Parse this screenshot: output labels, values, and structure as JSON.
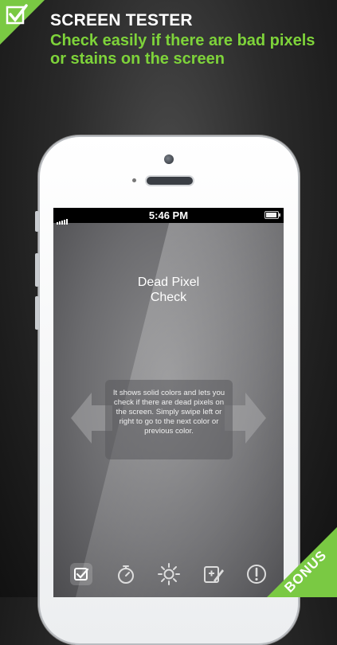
{
  "header": {
    "title": "SCREEN TESTER",
    "subtitle": "Check easily if there are bad pixels or stains on the screen"
  },
  "badge": {
    "label": "BONUS"
  },
  "status_bar": {
    "time": "5:46 PM"
  },
  "screen": {
    "title_line1": "Dead Pixel",
    "title_line2": "Check",
    "description": "It shows solid colors and lets you check if there are dead pixels on the screen. Simply swipe left or right to go to the next color or previous color."
  },
  "tab_bar": {
    "items": [
      "dead-pixel-check",
      "timer",
      "brightness",
      "touch-test",
      "info"
    ],
    "active": "dead-pixel-check"
  },
  "colors": {
    "accent": "#7ac943",
    "subtitle_green": "#7ed33a"
  }
}
